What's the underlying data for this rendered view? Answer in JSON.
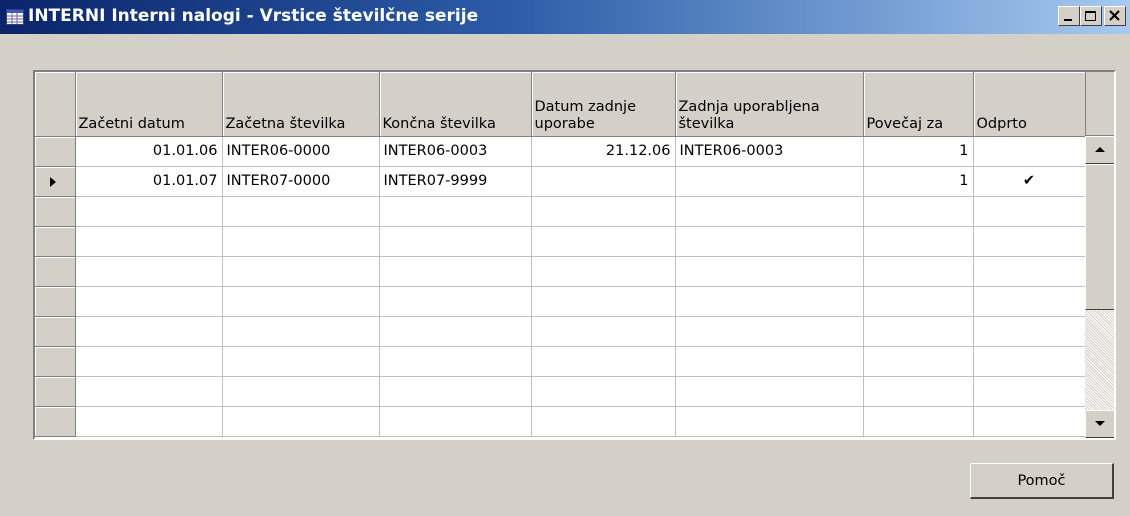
{
  "window": {
    "title": "INTERNI Interni nalogi - Vrstice številčne serije",
    "colors": {
      "title_start": "#0a246a",
      "title_end": "#a6caf0",
      "face": "#d4d0c8"
    }
  },
  "grid": {
    "columns": [
      {
        "key": "start_date",
        "label": "Začetni datum",
        "align": "right"
      },
      {
        "key": "start_no",
        "label": "Začetna številka",
        "align": "left"
      },
      {
        "key": "end_no",
        "label": "Končna številka",
        "align": "left"
      },
      {
        "key": "last_date",
        "label": "Datum zadnje uporabe",
        "align": "right"
      },
      {
        "key": "last_no",
        "label": "Zadnja uporabljena številka",
        "align": "left"
      },
      {
        "key": "increment",
        "label": "Povečaj za",
        "align": "right"
      },
      {
        "key": "open",
        "label": "Odprto",
        "align": "center"
      }
    ],
    "rows": [
      {
        "start_date": "01.01.06",
        "start_no": "INTER06-0000",
        "end_no": "INTER06-0003",
        "last_date": "21.12.06",
        "last_no": "INTER06-0003",
        "increment": "1",
        "open": ""
      },
      {
        "start_date": "01.01.07",
        "start_no": "INTER07-0000",
        "end_no": "INTER07-9999",
        "last_date": "",
        "last_no": "",
        "increment": "1",
        "open": "✔"
      },
      {
        "start_date": "",
        "start_no": "",
        "end_no": "",
        "last_date": "",
        "last_no": "",
        "increment": "",
        "open": ""
      },
      {
        "start_date": "",
        "start_no": "",
        "end_no": "",
        "last_date": "",
        "last_no": "",
        "increment": "",
        "open": ""
      },
      {
        "start_date": "",
        "start_no": "",
        "end_no": "",
        "last_date": "",
        "last_no": "",
        "increment": "",
        "open": ""
      },
      {
        "start_date": "",
        "start_no": "",
        "end_no": "",
        "last_date": "",
        "last_no": "",
        "increment": "",
        "open": ""
      },
      {
        "start_date": "",
        "start_no": "",
        "end_no": "",
        "last_date": "",
        "last_no": "",
        "increment": "",
        "open": ""
      },
      {
        "start_date": "",
        "start_no": "",
        "end_no": "",
        "last_date": "",
        "last_no": "",
        "increment": "",
        "open": ""
      },
      {
        "start_date": "",
        "start_no": "",
        "end_no": "",
        "last_date": "",
        "last_no": "",
        "increment": "",
        "open": ""
      },
      {
        "start_date": "",
        "start_no": "",
        "end_no": "",
        "last_date": "",
        "last_no": "",
        "increment": "",
        "open": ""
      }
    ],
    "current_row": 1
  },
  "buttons": {
    "help_label": "Pomoč"
  },
  "icons": {
    "title": "table-icon",
    "minimize": "minimize-icon",
    "maximize": "maximize-icon",
    "close": "close-icon",
    "scroll_up": "arrow-up-icon",
    "scroll_down": "arrow-down-icon",
    "row_pointer": "row-pointer-icon"
  }
}
